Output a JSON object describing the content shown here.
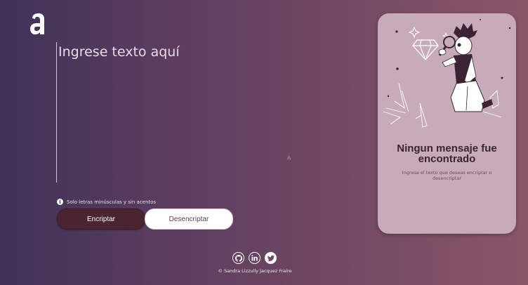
{
  "logo": {
    "letter": "a",
    "icon": "alura-logo"
  },
  "input": {
    "placeholder": "Ingrese texto aquí",
    "value": ""
  },
  "hint": {
    "icon": "info-icon",
    "text": "Solo letras minúsculas y sin acentos"
  },
  "buttons": {
    "encrypt_label": "Encriptar",
    "decrypt_label": "Desencriptar"
  },
  "panel": {
    "illustration": "person-with-magnifier-illustration",
    "title": "Ningun mensaje fue encontrado",
    "subtitle": "Ingresa el texto que deseas encriptar o desencriptar"
  },
  "footer": {
    "icons": [
      "github-icon",
      "linkedin-icon",
      "twitter-icon"
    ],
    "copyright": "© Sandra Lizzully Jacquez Fraire"
  },
  "colors": {
    "encrypt_button": "#4a2430",
    "panel_bg": "#c7abba",
    "gradient_start": "#3f3258",
    "gradient_end": "#8a5668"
  }
}
